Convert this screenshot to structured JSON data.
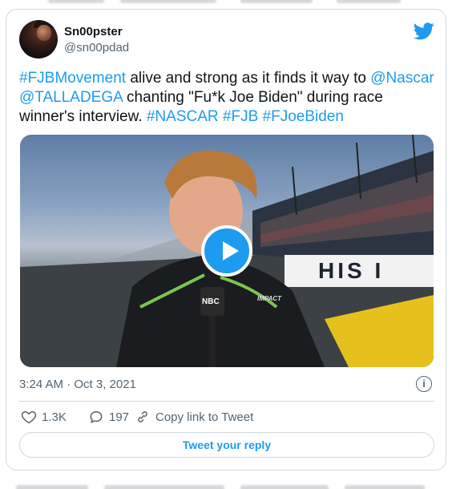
{
  "user": {
    "display_name": "Sn00pster",
    "handle": "@sn00pdad"
  },
  "tweet": {
    "text_parts": [
      {
        "text": "#FJBMovement",
        "link": true
      },
      {
        "text": " alive and strong as it finds it way to ",
        "link": false
      },
      {
        "text": "@Nascar",
        "link": true
      },
      {
        "text": "  ",
        "link": false
      },
      {
        "text": "@TALLADEGA",
        "link": true
      },
      {
        "text": " chanting \"Fu*k Joe Biden\" during race winner's interview. ",
        "link": false
      },
      {
        "text": "#NASCAR",
        "link": true
      },
      {
        "text": "  ",
        "link": false
      },
      {
        "text": "#FJB",
        "link": true
      },
      {
        "text": " ",
        "link": false
      },
      {
        "text": "#FJoeBiden",
        "link": true
      }
    ],
    "media": {
      "type": "video",
      "play_icon": "play-icon",
      "banner_text": "HIS I",
      "mic_text": "NBC",
      "sponsor_text": "IMPACT"
    },
    "timestamp": "3:24 AM · Oct 3, 2021"
  },
  "actions": {
    "likes": "1.3K",
    "replies": "197",
    "copy_link": "Copy link to Tweet"
  },
  "reply_button": "Tweet your reply",
  "colors": {
    "accent": "#1d9bf0",
    "text": "#0f1419",
    "secondary": "#536471",
    "border": "#cfd9de"
  }
}
